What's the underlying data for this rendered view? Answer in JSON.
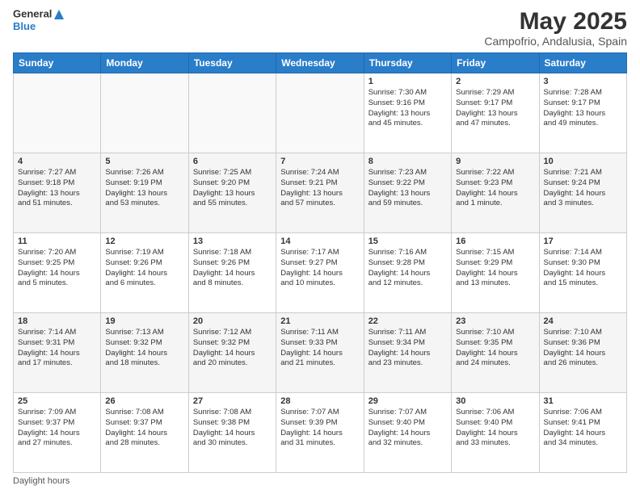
{
  "header": {
    "logo_general": "General",
    "logo_blue": "Blue",
    "main_title": "May 2025",
    "subtitle": "Campofrio, Andalusia, Spain"
  },
  "days_of_week": [
    "Sunday",
    "Monday",
    "Tuesday",
    "Wednesday",
    "Thursday",
    "Friday",
    "Saturday"
  ],
  "weeks": [
    [
      {
        "num": "",
        "info": ""
      },
      {
        "num": "",
        "info": ""
      },
      {
        "num": "",
        "info": ""
      },
      {
        "num": "",
        "info": ""
      },
      {
        "num": "1",
        "info": "Sunrise: 7:30 AM\nSunset: 9:16 PM\nDaylight: 13 hours\nand 45 minutes."
      },
      {
        "num": "2",
        "info": "Sunrise: 7:29 AM\nSunset: 9:17 PM\nDaylight: 13 hours\nand 47 minutes."
      },
      {
        "num": "3",
        "info": "Sunrise: 7:28 AM\nSunset: 9:17 PM\nDaylight: 13 hours\nand 49 minutes."
      }
    ],
    [
      {
        "num": "4",
        "info": "Sunrise: 7:27 AM\nSunset: 9:18 PM\nDaylight: 13 hours\nand 51 minutes."
      },
      {
        "num": "5",
        "info": "Sunrise: 7:26 AM\nSunset: 9:19 PM\nDaylight: 13 hours\nand 53 minutes."
      },
      {
        "num": "6",
        "info": "Sunrise: 7:25 AM\nSunset: 9:20 PM\nDaylight: 13 hours\nand 55 minutes."
      },
      {
        "num": "7",
        "info": "Sunrise: 7:24 AM\nSunset: 9:21 PM\nDaylight: 13 hours\nand 57 minutes."
      },
      {
        "num": "8",
        "info": "Sunrise: 7:23 AM\nSunset: 9:22 PM\nDaylight: 13 hours\nand 59 minutes."
      },
      {
        "num": "9",
        "info": "Sunrise: 7:22 AM\nSunset: 9:23 PM\nDaylight: 14 hours\nand 1 minute."
      },
      {
        "num": "10",
        "info": "Sunrise: 7:21 AM\nSunset: 9:24 PM\nDaylight: 14 hours\nand 3 minutes."
      }
    ],
    [
      {
        "num": "11",
        "info": "Sunrise: 7:20 AM\nSunset: 9:25 PM\nDaylight: 14 hours\nand 5 minutes."
      },
      {
        "num": "12",
        "info": "Sunrise: 7:19 AM\nSunset: 9:26 PM\nDaylight: 14 hours\nand 6 minutes."
      },
      {
        "num": "13",
        "info": "Sunrise: 7:18 AM\nSunset: 9:26 PM\nDaylight: 14 hours\nand 8 minutes."
      },
      {
        "num": "14",
        "info": "Sunrise: 7:17 AM\nSunset: 9:27 PM\nDaylight: 14 hours\nand 10 minutes."
      },
      {
        "num": "15",
        "info": "Sunrise: 7:16 AM\nSunset: 9:28 PM\nDaylight: 14 hours\nand 12 minutes."
      },
      {
        "num": "16",
        "info": "Sunrise: 7:15 AM\nSunset: 9:29 PM\nDaylight: 14 hours\nand 13 minutes."
      },
      {
        "num": "17",
        "info": "Sunrise: 7:14 AM\nSunset: 9:30 PM\nDaylight: 14 hours\nand 15 minutes."
      }
    ],
    [
      {
        "num": "18",
        "info": "Sunrise: 7:14 AM\nSunset: 9:31 PM\nDaylight: 14 hours\nand 17 minutes."
      },
      {
        "num": "19",
        "info": "Sunrise: 7:13 AM\nSunset: 9:32 PM\nDaylight: 14 hours\nand 18 minutes."
      },
      {
        "num": "20",
        "info": "Sunrise: 7:12 AM\nSunset: 9:32 PM\nDaylight: 14 hours\nand 20 minutes."
      },
      {
        "num": "21",
        "info": "Sunrise: 7:11 AM\nSunset: 9:33 PM\nDaylight: 14 hours\nand 21 minutes."
      },
      {
        "num": "22",
        "info": "Sunrise: 7:11 AM\nSunset: 9:34 PM\nDaylight: 14 hours\nand 23 minutes."
      },
      {
        "num": "23",
        "info": "Sunrise: 7:10 AM\nSunset: 9:35 PM\nDaylight: 14 hours\nand 24 minutes."
      },
      {
        "num": "24",
        "info": "Sunrise: 7:10 AM\nSunset: 9:36 PM\nDaylight: 14 hours\nand 26 minutes."
      }
    ],
    [
      {
        "num": "25",
        "info": "Sunrise: 7:09 AM\nSunset: 9:37 PM\nDaylight: 14 hours\nand 27 minutes."
      },
      {
        "num": "26",
        "info": "Sunrise: 7:08 AM\nSunset: 9:37 PM\nDaylight: 14 hours\nand 28 minutes."
      },
      {
        "num": "27",
        "info": "Sunrise: 7:08 AM\nSunset: 9:38 PM\nDaylight: 14 hours\nand 30 minutes."
      },
      {
        "num": "28",
        "info": "Sunrise: 7:07 AM\nSunset: 9:39 PM\nDaylight: 14 hours\nand 31 minutes."
      },
      {
        "num": "29",
        "info": "Sunrise: 7:07 AM\nSunset: 9:40 PM\nDaylight: 14 hours\nand 32 minutes."
      },
      {
        "num": "30",
        "info": "Sunrise: 7:06 AM\nSunset: 9:40 PM\nDaylight: 14 hours\nand 33 minutes."
      },
      {
        "num": "31",
        "info": "Sunrise: 7:06 AM\nSunset: 9:41 PM\nDaylight: 14 hours\nand 34 minutes."
      }
    ]
  ],
  "footer": {
    "label": "Daylight hours"
  }
}
